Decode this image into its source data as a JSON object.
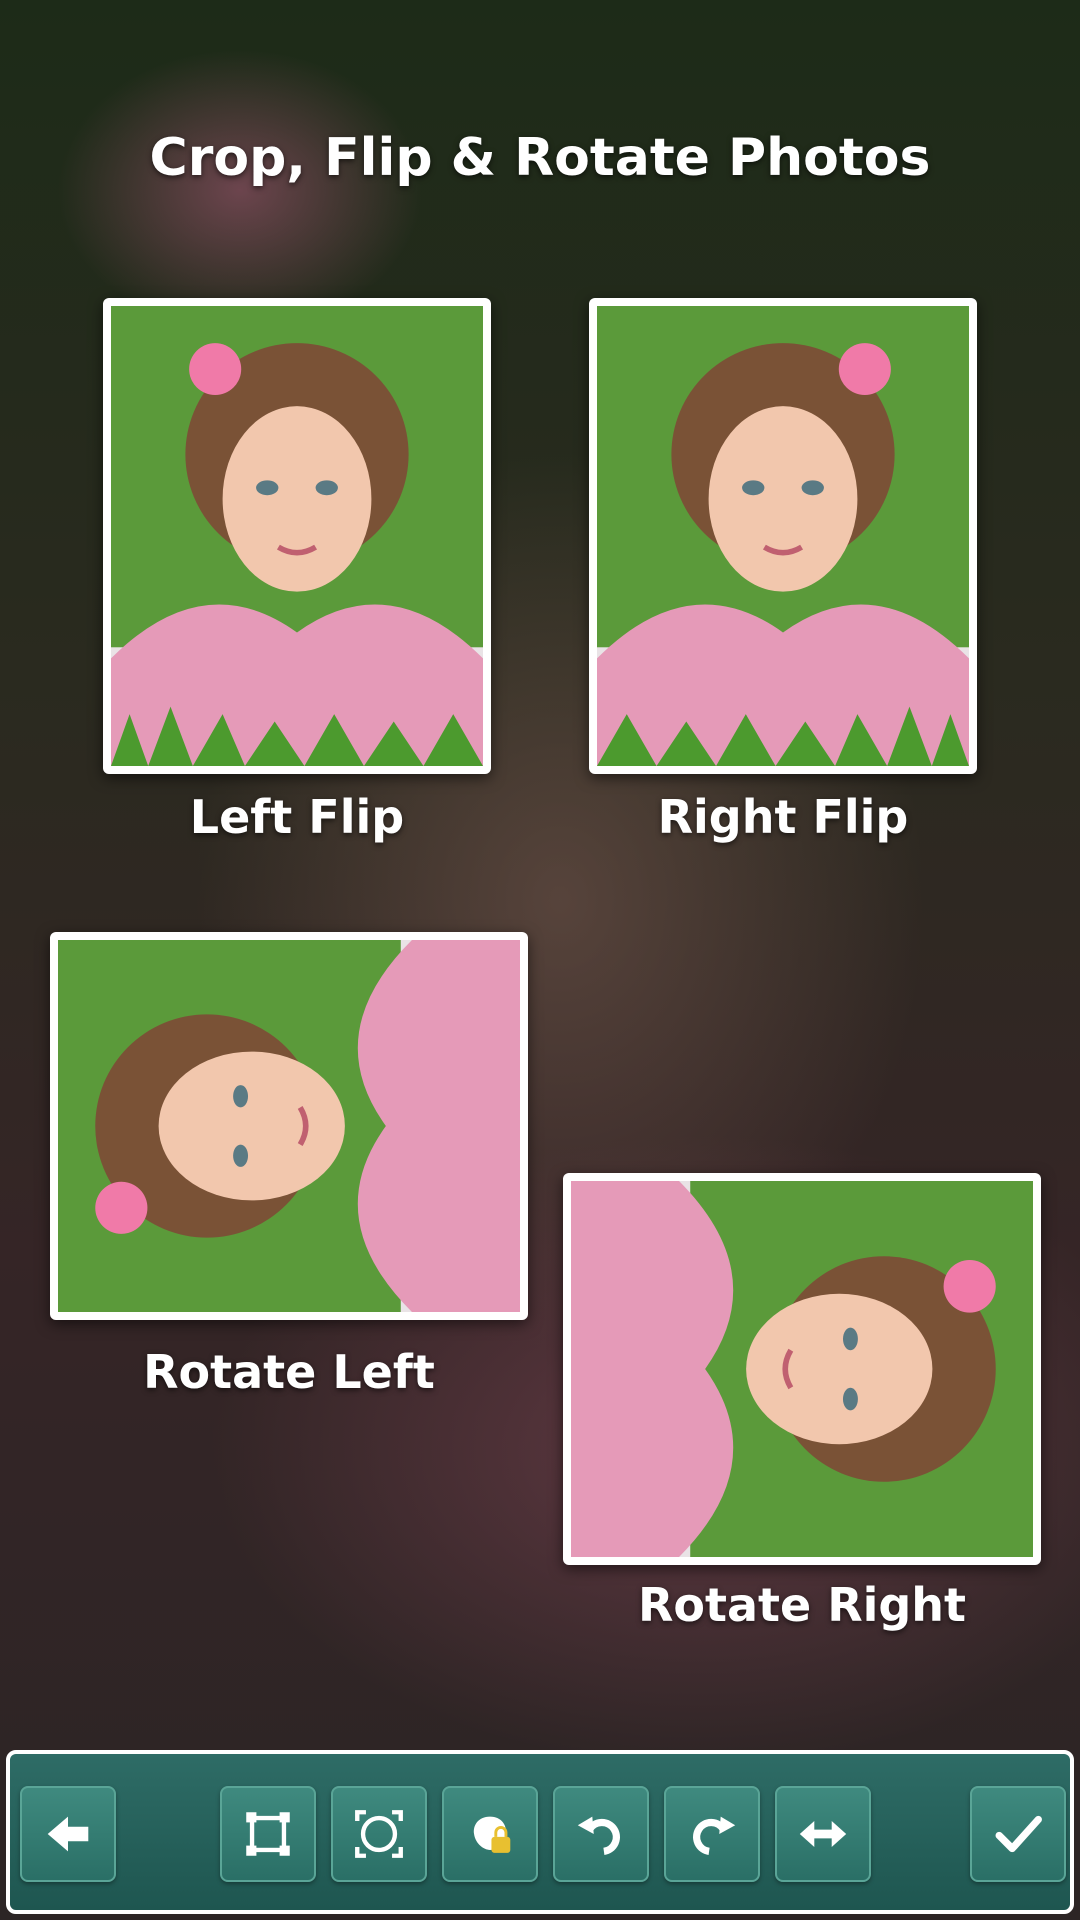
{
  "headline": "Crop, Flip & Rotate Photos",
  "captions": {
    "left_flip": "Left Flip",
    "right_flip": "Right Flip",
    "rotate_left": "Rotate Left",
    "rotate_right": "Rotate Right"
  },
  "toolbar": {
    "buttons": [
      {
        "icon": "back-arrow-icon"
      },
      {
        "icon": "crop-square-icon"
      },
      {
        "icon": "crop-circle-icon"
      },
      {
        "icon": "lock-shape-icon"
      },
      {
        "icon": "rotate-left-icon"
      },
      {
        "icon": "rotate-right-icon"
      },
      {
        "icon": "flip-horizontal-icon"
      },
      {
        "icon": "checkmark-icon"
      }
    ]
  },
  "colors": {
    "toolbar_bg": "#1e5650",
    "button_bg": "#3f8a7f",
    "photo_border": "#ffffff",
    "text": "#ffffff"
  }
}
